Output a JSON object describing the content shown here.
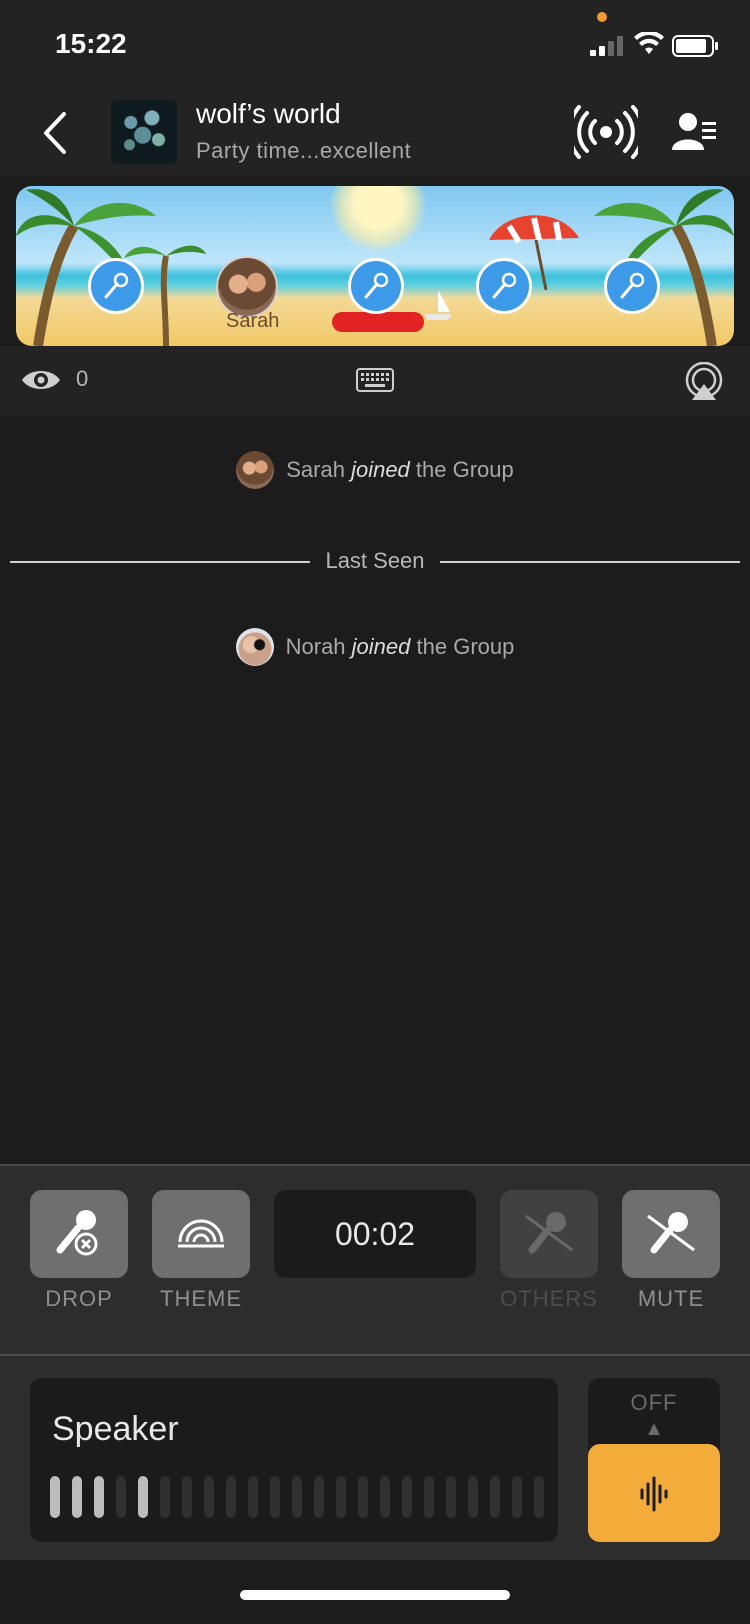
{
  "status_bar": {
    "time": "15:22"
  },
  "header": {
    "group_name": "wolf’s world",
    "group_status": "Party time...excellent"
  },
  "banner": {
    "seated_user_name": "Sarah",
    "empty_seats": 4
  },
  "info_bar": {
    "viewer_count": "0"
  },
  "feed": {
    "events": [
      {
        "name": "Sarah",
        "action": "joined",
        "suffix": "the Group"
      },
      {
        "name": "Norah",
        "action": "joined",
        "suffix": "the Group"
      }
    ],
    "divider_label": "Last Seen"
  },
  "controls": {
    "drop_label": "DROP",
    "theme_label": "THEME",
    "timer": "00:02",
    "others_label": "OTHERS",
    "mute_label": "MUTE"
  },
  "speaker": {
    "label": "Speaker",
    "level_active_bars": [
      0,
      1,
      2,
      4
    ],
    "level_total_bars": 23,
    "off_label": "OFF",
    "off_arrow": "▲"
  },
  "colors": {
    "accent_orange": "#f3ac3a",
    "seat_blue": "#3d9ae8",
    "background": "#1c1c1c"
  }
}
